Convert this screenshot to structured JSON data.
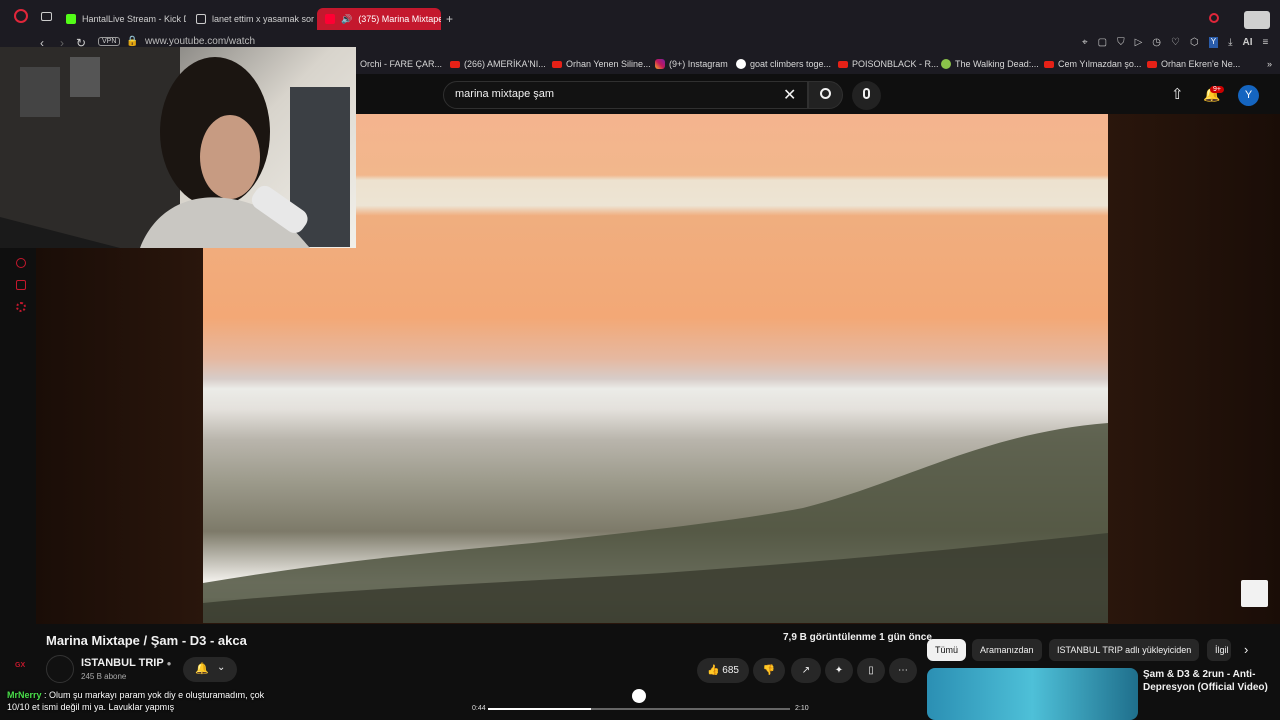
{
  "browser": {
    "tabs": [
      {
        "label": "HantalLive Stream - Kick D...",
        "color": "#53fc18"
      },
      {
        "label": "lanet ettim x yasamak soru...",
        "color": "#d0d0d0"
      },
      {
        "label": "(375) Marina Mixtape /",
        "color": "#ffffff"
      }
    ],
    "url": "www.youtube.com/watch",
    "vpn": "VPN",
    "ai_label": "AI"
  },
  "bookmarks": [
    {
      "label": "Orchi - FARE ÇAR...",
      "icon": "youtube-icon"
    },
    {
      "label": "(266) AMERİKA'NI...",
      "icon": "youtube-icon"
    },
    {
      "label": "Orhan Yenen Siline...",
      "icon": "youtube-icon"
    },
    {
      "label": "(9+) Instagram",
      "icon": "instagram-icon"
    },
    {
      "label": "goat climbers toge...",
      "icon": "google-icon"
    },
    {
      "label": "POISONBLACK - R...",
      "icon": "youtube-icon"
    },
    {
      "label": "The Walking Dead:...",
      "icon": "green-icon"
    },
    {
      "label": "Cem Yılmazdan şo...",
      "icon": "youtube-icon"
    },
    {
      "label": "Orhan Ekren'e Ne...",
      "icon": "youtube-icon"
    }
  ],
  "youtube": {
    "search_query": "marina mixtape şam",
    "notif_count": "9+",
    "avatar_letter": "Y"
  },
  "video": {
    "title": "Marina Mixtape / Şam - D3 - akca",
    "channel": "ISTANBUL TRIP",
    "subscribers": "245 B abone",
    "views_line": "7,9 B görüntülenme  1 gün önce",
    "likes": "685",
    "time_current": "0:44",
    "time_total": "2:10",
    "progress": 0.34
  },
  "chips": [
    "Tümü",
    "Aramanızdan",
    "ISTANBUL TRIP adlı yükleyiciden",
    "İlgil"
  ],
  "recommendation": {
    "title": "Şam & D3 & 2run - Anti-Depresyon (Official Video)"
  },
  "chat": {
    "user": "MrNerry",
    "message": "Olum şu markayı param yok diy e oluşturamadım, çok 10/10 et ismi değil mi ya. Lavuklar yapmış"
  },
  "sidebar_badge": "GX"
}
